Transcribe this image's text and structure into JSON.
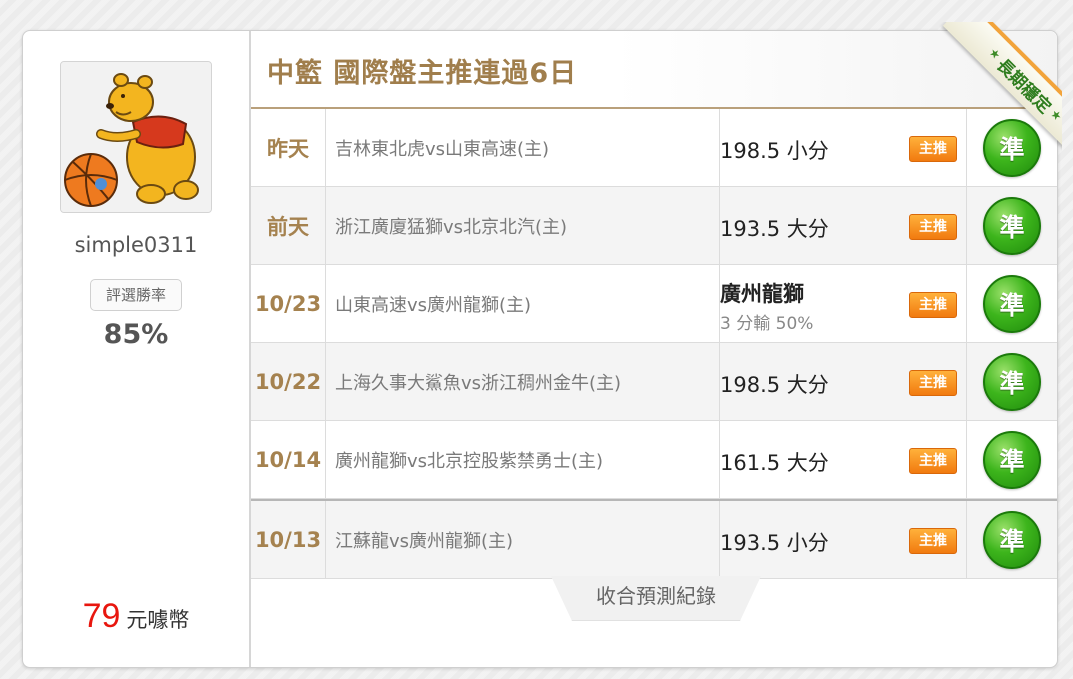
{
  "profile": {
    "username": "simple0311",
    "win_rate_label": "評選勝率",
    "win_rate_value": "85%",
    "coins_value": "79",
    "coins_unit": "元噱幣"
  },
  "header": {
    "title": "中籃 國際盤主推連過6日",
    "ribbon_label": "長期穩定"
  },
  "colors": {
    "title_brown": "#a07e4c",
    "badge_orange": "#f17a0f",
    "result_green": "#3db51c",
    "coins_red": "#e8160e"
  },
  "predictions": [
    {
      "date": "昨天",
      "match": "吉林東北虎vs山東高速(主)",
      "pick": "198.5 小分",
      "pick_sub": "",
      "badge": "主推",
      "result": "準"
    },
    {
      "date": "前天",
      "match": "浙江廣廈猛獅vs北京北汽(主)",
      "pick": "193.5 大分",
      "pick_sub": "",
      "badge": "主推",
      "result": "準"
    },
    {
      "date": "10/23",
      "match": "山東高速vs廣州龍獅(主)",
      "pick": "廣州龍獅",
      "pick_sub": "3 分輸 50%",
      "badge": "主推",
      "result": "準"
    },
    {
      "date": "10/22",
      "match": "上海久事大鯊魚vs浙江稠州金牛(主)",
      "pick": "198.5 大分",
      "pick_sub": "",
      "badge": "主推",
      "result": "準"
    },
    {
      "date": "10/14",
      "match": "廣州龍獅vs北京控股紫禁勇士(主)",
      "pick": "161.5 大分",
      "pick_sub": "",
      "badge": "主推",
      "result": "準"
    },
    {
      "date": "10/13",
      "match": "江蘇龍vs廣州龍獅(主)",
      "pick": "193.5 小分",
      "pick_sub": "",
      "badge": "主推",
      "result": "準"
    }
  ],
  "collapse_label": "收合預測紀錄"
}
